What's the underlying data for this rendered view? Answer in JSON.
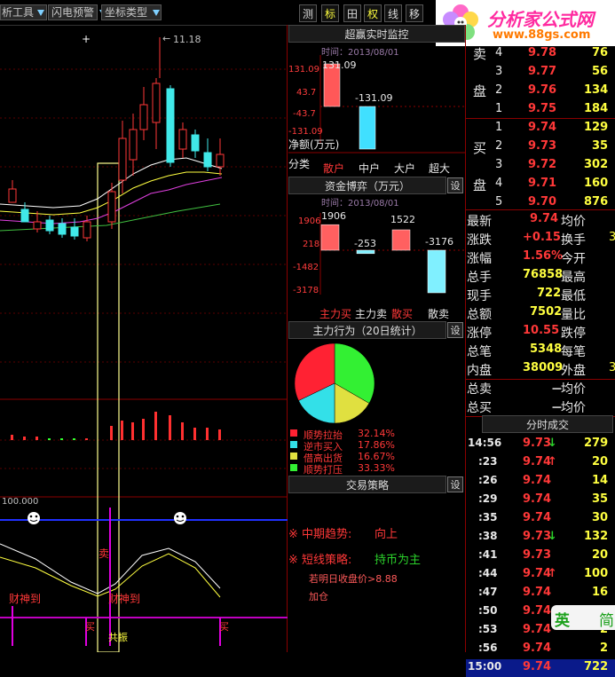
{
  "toolbar": {
    "tools_label": "析工具",
    "flash_label": "闪电预警",
    "coord_label": "坐标类型",
    "btn_measure": "测",
    "btn_mark": "标",
    "btn_grid": "田",
    "btn_quan": "权",
    "btn_line": "线",
    "btn_move": "移"
  },
  "logo": {
    "title": "分析家公式网",
    "url": "www.88gs.com",
    "brand_color": "#ff2aa0"
  },
  "kline": {
    "high_label": "11.18",
    "indicator_scale": "100.000",
    "signals": [
      "财神到",
      "财神到"
    ],
    "buy_marks": [
      "买",
      "买"
    ],
    "sell_mark": "卖",
    "resonance": "共振",
    "price_marker": "+"
  },
  "monitor": {
    "title": "超赢实时监控",
    "time": "时间：2013/08/01",
    "yticks": [
      "131.09",
      "43.7",
      "-43.7",
      "-131.09"
    ],
    "net_label": "净额(万元)",
    "bar_labels": [
      "131.09",
      "-131.09"
    ],
    "bar_values": [
      131.09,
      -131.09,
      0,
      0
    ],
    "cat_label": "分类",
    "categories": [
      "散户",
      "中户",
      "大户",
      "超大"
    ]
  },
  "capital": {
    "title": "资金博弈（万元）",
    "set": "设",
    "time": "时间：2013/08/01",
    "yticks": [
      "1906",
      "218",
      "-1482",
      "-3178"
    ],
    "bar_labels": [
      "1906",
      "-253",
      "1522",
      "-3176"
    ],
    "bar_values": [
      1906,
      -253,
      1522,
      -3176
    ],
    "categories": [
      "主力买",
      "主力卖",
      "散买",
      "散卖"
    ]
  },
  "behavior": {
    "title": "主力行为（20日统计）",
    "set": "设",
    "legend": [
      {
        "label": "顺势拉抬",
        "value": "32.14%",
        "pct": 32.14,
        "color": "#ff2233"
      },
      {
        "label": "逆市买入",
        "value": "17.86%",
        "pct": 17.86,
        "color": "#33e0e8"
      },
      {
        "label": "借高出货",
        "value": "16.67%",
        "pct": 16.67,
        "color": "#e0e040"
      },
      {
        "label": "顺势打压",
        "value": "33.33%",
        "pct": 33.33,
        "color": "#33f033"
      }
    ]
  },
  "strategy": {
    "title": "交易策略",
    "set": "设",
    "mid_label": "※ 中期趋势:",
    "mid_value": "向上",
    "short_label": "※ 短线策略:",
    "short_value": "持币为主",
    "note1": "若明日收盘价>8.88",
    "note2": "加仓"
  },
  "orderbook": {
    "sell_label": [
      "卖",
      "盘"
    ],
    "buy_label": [
      "买",
      "盘"
    ],
    "sell": [
      {
        "lv": "4",
        "price": "9.78",
        "vol": "76"
      },
      {
        "lv": "3",
        "price": "9.77",
        "vol": "56"
      },
      {
        "lv": "2",
        "price": "9.76",
        "vol": "134"
      },
      {
        "lv": "1",
        "price": "9.75",
        "vol": "184"
      }
    ],
    "buy": [
      {
        "lv": "1",
        "price": "9.74",
        "vol": "129"
      },
      {
        "lv": "2",
        "price": "9.73",
        "vol": "35"
      },
      {
        "lv": "3",
        "price": "9.72",
        "vol": "302"
      },
      {
        "lv": "4",
        "price": "9.71",
        "vol": "160"
      },
      {
        "lv": "5",
        "price": "9.70",
        "vol": "876"
      }
    ]
  },
  "quote": [
    {
      "k1": "最新",
      "v1": "9.74",
      "k2": "均价",
      "v2": ""
    },
    {
      "k1": "涨跌",
      "v1": "+0.15",
      "k2": "换手",
      "v2": "3"
    },
    {
      "k1": "涨幅",
      "v1": "1.56%",
      "k2": "今开",
      "v2": ""
    },
    {
      "k1": "总手",
      "v1": "76858",
      "k2": "最高",
      "v2": ""
    },
    {
      "k1": "现手",
      "v1": "722",
      "k2": "最低",
      "v2": ""
    },
    {
      "k1": "总额",
      "v1": "7502",
      "k2": "量比",
      "v2": ""
    },
    {
      "k1": "涨停",
      "v1": "10.55",
      "k2": "跌停",
      "v2": ""
    },
    {
      "k1": "总笔",
      "v1": "5348",
      "k2": "每笔",
      "v2": ""
    },
    {
      "k1": "内盘",
      "v1": "38009",
      "k2": "外盘",
      "v2": "3"
    },
    {
      "k1": "总卖",
      "v1": "－",
      "k2": "均价",
      "v2": ""
    },
    {
      "k1": "总买",
      "v1": "－",
      "k2": "均价",
      "v2": ""
    }
  ],
  "ticks": {
    "title": "分时成交",
    "rows": [
      {
        "t": "14:56",
        "p": "9.73",
        "dir": "down",
        "v": "279"
      },
      {
        "t": ":23",
        "p": "9.74",
        "dir": "up",
        "v": "20"
      },
      {
        "t": ":26",
        "p": "9.74",
        "dir": "",
        "v": "14"
      },
      {
        "t": ":29",
        "p": "9.74",
        "dir": "",
        "v": "35"
      },
      {
        "t": ":35",
        "p": "9.74",
        "dir": "",
        "v": "30"
      },
      {
        "t": ":38",
        "p": "9.73",
        "dir": "down",
        "v": "132"
      },
      {
        "t": ":41",
        "p": "9.73",
        "dir": "",
        "v": "20"
      },
      {
        "t": ":44",
        "p": "9.74",
        "dir": "up",
        "v": "100"
      },
      {
        "t": ":47",
        "p": "9.74",
        "dir": "",
        "v": "16"
      },
      {
        "t": ":50",
        "p": "9.74",
        "dir": "",
        "v": "5"
      },
      {
        "t": ":53",
        "p": "9.74",
        "dir": "",
        "v": "2"
      },
      {
        "t": ":56",
        "p": "9.74",
        "dir": "",
        "v": "2"
      },
      {
        "t": "15:00",
        "p": "9.74",
        "dir": "",
        "v": "722"
      }
    ]
  },
  "watermark": {
    "text": "英",
    "text2": "简"
  }
}
